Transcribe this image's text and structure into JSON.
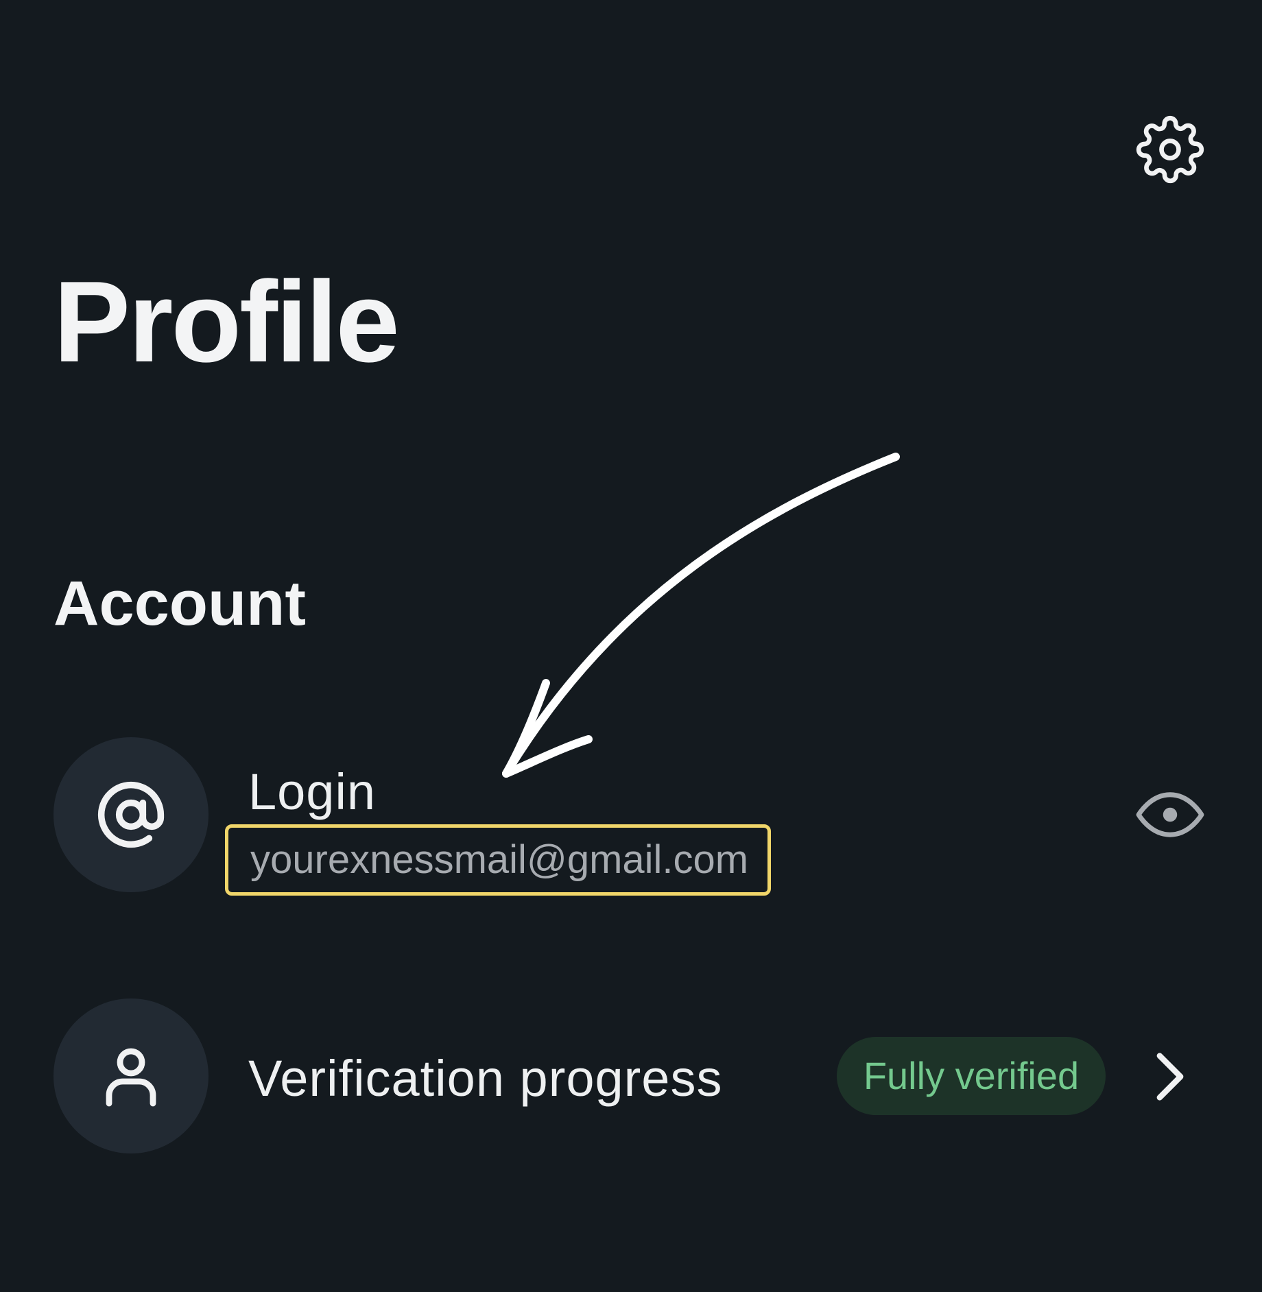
{
  "header": {
    "settings_icon": "gear-icon"
  },
  "page": {
    "title": "Profile"
  },
  "account": {
    "section_title": "Account",
    "login": {
      "icon": "at-sign-icon",
      "label": "Login",
      "value": "yourexnessmail@gmail.com",
      "toggle_icon": "eye-icon"
    },
    "verification": {
      "icon": "person-icon",
      "label": "Verification progress",
      "status": "Fully verified",
      "chevron_icon": "chevron-right-icon"
    }
  },
  "colors": {
    "background": "#141a1f",
    "avatar_bg": "#222a33",
    "highlight_border": "#f1d66a",
    "badge_bg": "#1d3328",
    "badge_text": "#74c98e"
  }
}
